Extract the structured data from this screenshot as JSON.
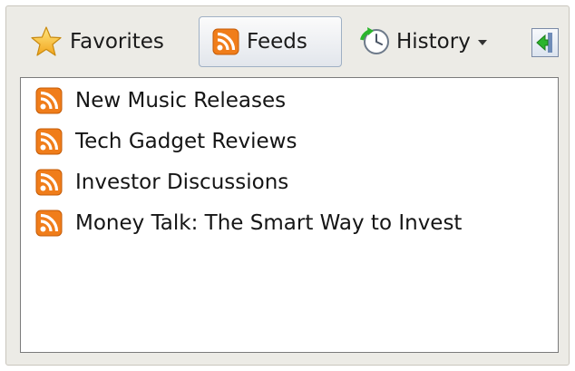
{
  "toolbar": {
    "favorites_label": "Favorites",
    "feeds_label": "Feeds",
    "history_label": "History"
  },
  "feeds": [
    {
      "label": "New Music Releases"
    },
    {
      "label": "Tech Gadget Reviews"
    },
    {
      "label": "Investor Discussions"
    },
    {
      "label": "Money Talk: The Smart Way to Invest"
    }
  ],
  "colors": {
    "rss_orange": "#f07d1a",
    "pane_background": "#ecebe6",
    "list_background": "#ffffff",
    "sync_arrow_green": "#2bb52b"
  },
  "icons": {
    "favorites": "star-icon",
    "feeds": "rss-icon",
    "history": "clock-history-icon",
    "sync": "sync-to-tab-icon"
  }
}
